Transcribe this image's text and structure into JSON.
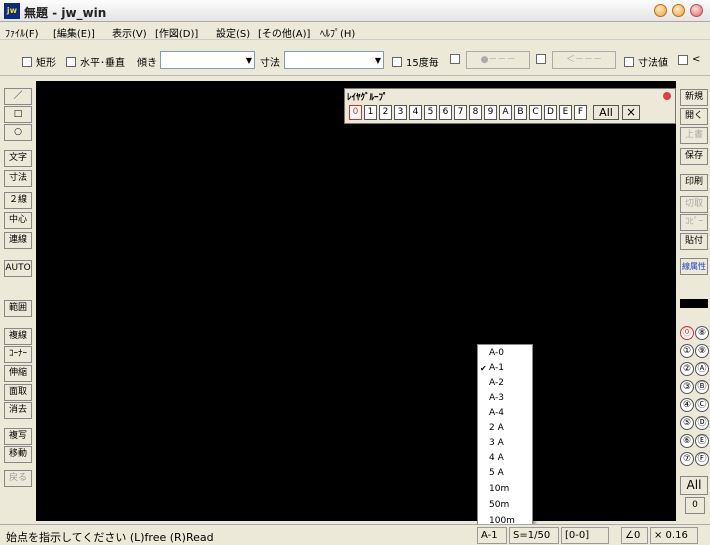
{
  "window": {
    "title": "無題 - jw_win",
    "icon": "jw-app-icon"
  },
  "menu": [
    "ﾌｧｲﾙ(F)",
    "[編集(E)]",
    "表示(V)",
    "[作図(D)]",
    "設定(S)",
    "[その他(A)]",
    "ﾍﾙﾌﾟ(H)"
  ],
  "toolbar": {
    "rect_label": "矩形",
    "hv_label": "水平･垂直",
    "tilt_label": "傾き",
    "tilt_value": "",
    "dim_label": "寸法",
    "dim_value": "",
    "deg15_label": "15度毎",
    "dimval_label": "寸法値",
    "lt_label": "<",
    "dots1": "●－－－",
    "dots2": "＜－－－"
  },
  "left_tools": [
    "／",
    "□",
    "○",
    "文字",
    "寸法",
    "２線",
    "中心線",
    "連線",
    "AUTO",
    "範囲",
    "複線",
    "ｺｰﾅｰ",
    "伸縮",
    "面取",
    "消去",
    "複写",
    "移動",
    "戻る"
  ],
  "right_tools": [
    "新規",
    "開く",
    "上書",
    "保存",
    "印刷",
    "切取",
    "ｺﾋﾟｰ",
    "貼付",
    "線属性"
  ],
  "layer_group": {
    "title": "ﾚｲﾔｸﾞﾙｰﾌﾟ",
    "buttons": [
      "0",
      "1",
      "2",
      "3",
      "4",
      "5",
      "6",
      "7",
      "8",
      "9",
      "A",
      "B",
      "C",
      "D",
      "E",
      "F"
    ],
    "all": "All",
    "x": "×"
  },
  "layers_right": {
    "col1": [
      "⓪",
      "①",
      "②",
      "③",
      "④",
      "⑤",
      "⑥",
      "⑦"
    ],
    "col2": [
      "⑧",
      "⑨",
      "Ⓐ",
      "Ⓑ",
      "Ⓒ",
      "Ⓓ",
      "Ⓔ",
      "Ⓕ"
    ],
    "all": "All",
    "zero": "0"
  },
  "paper_menu": {
    "items": [
      "A-0",
      "A-1",
      "A-2",
      "A-3",
      "A-4",
      "2 A",
      "3 A",
      "4 A",
      "5 A",
      "10m",
      "50m",
      "100m"
    ],
    "selected": "A-1"
  },
  "status": {
    "message": "始点を指示してください (L)free (R)Read",
    "paper": "A-1",
    "scale": "S=1/50",
    "layer": "[0-0]",
    "angle": "∠0",
    "zoom": "× 0.16"
  }
}
